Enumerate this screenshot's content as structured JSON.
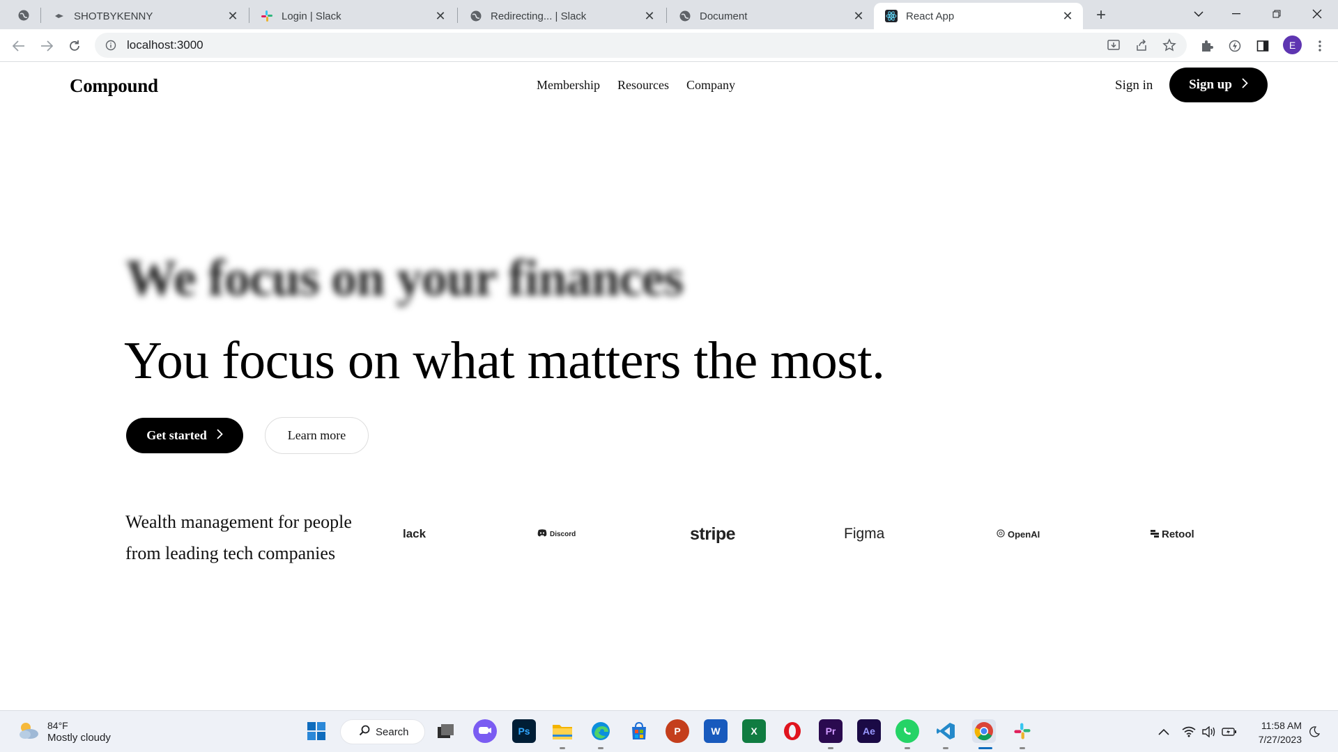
{
  "browser": {
    "tabs": [
      {
        "title": "SHOTBYKENNY",
        "favicon": "globe-icon",
        "active": false
      },
      {
        "title": "Login | Slack",
        "favicon": "slack-icon",
        "active": false
      },
      {
        "title": "Redirecting... | Slack",
        "favicon": "globe-icon",
        "active": false
      },
      {
        "title": "Document",
        "favicon": "globe-icon",
        "active": false
      },
      {
        "title": "React App",
        "favicon": "react-icon",
        "active": true
      }
    ],
    "url": "localhost:3000",
    "profile_initial": "E"
  },
  "page": {
    "logo": "Compound",
    "nav": [
      "Membership",
      "Resources",
      "Company"
    ],
    "sign_in": "Sign in",
    "sign_up": "Sign up",
    "hero_blurred": "We focus on your finances",
    "hero_title": "You focus on what matters the most.",
    "cta_primary": "Get started",
    "cta_secondary": "Learn more",
    "wealth_text": "Wealth management for people from leading tech companies",
    "brands": [
      "lack",
      "Discord",
      "stripe",
      "Figma",
      "OpenAI",
      "Retool"
    ]
  },
  "taskbar": {
    "weather_temp": "84°F",
    "weather_condition": "Mostly cloudy",
    "search_label": "Search",
    "time": "11:58 AM",
    "date": "7/27/2023"
  }
}
